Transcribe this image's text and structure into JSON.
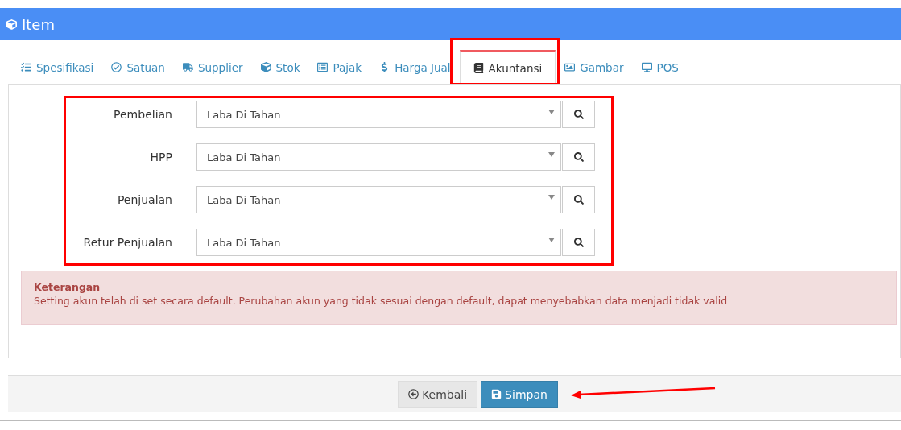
{
  "header": {
    "title": "Item"
  },
  "tabs": [
    {
      "label": "Spesifikasi",
      "selected": false,
      "highlighted": false
    },
    {
      "label": "Satuan",
      "selected": false,
      "highlighted": false
    },
    {
      "label": "Supplier",
      "selected": false,
      "highlighted": false
    },
    {
      "label": "Stok",
      "selected": false,
      "highlighted": false
    },
    {
      "label": "Pajak",
      "selected": false,
      "highlighted": false
    },
    {
      "label": "Harga Jual",
      "selected": false,
      "highlighted": false
    },
    {
      "label": "Akuntansi",
      "selected": true,
      "highlighted": true
    },
    {
      "label": "Gambar",
      "selected": false,
      "highlighted": false
    },
    {
      "label": "POS",
      "selected": false,
      "highlighted": false
    }
  ],
  "form": {
    "highlighted": true,
    "fields": [
      {
        "label": "Pembelian",
        "value": "Laba Di Tahan"
      },
      {
        "label": "HPP",
        "value": "Laba Di Tahan"
      },
      {
        "label": "Penjualan",
        "value": "Laba Di Tahan"
      },
      {
        "label": "Retur Penjualan",
        "value": "Laba Di Tahan"
      }
    ]
  },
  "alert": {
    "title": "Keterangan",
    "text": "Setting akun telah di set secara default. Perubahan akun yang tidak sesuai dengan default, dapat menyebabkan data menjadi tidak valid"
  },
  "buttons": [
    {
      "label": "Kembali",
      "kind": "back",
      "annotated": false
    },
    {
      "label": "Simpan",
      "kind": "save",
      "annotated": true
    }
  ]
}
